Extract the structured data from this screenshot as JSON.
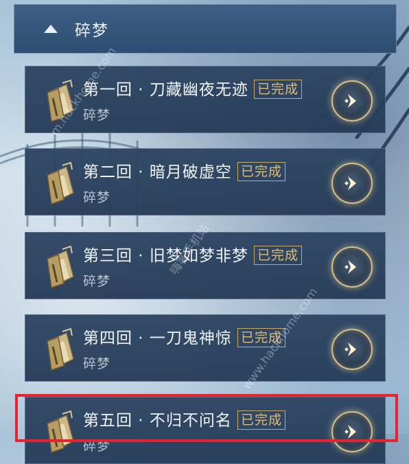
{
  "header": {
    "title": "碎梦",
    "chevron_icon": "chevron-up-icon"
  },
  "chapters": [
    {
      "name": "第一回 · 刀藏幽夜无迹",
      "status": "已完成",
      "subtitle": "碎梦"
    },
    {
      "name": "第二回 · 暗月破虚空",
      "status": "已完成",
      "subtitle": "碎梦"
    },
    {
      "name": "第三回 · 旧梦如梦非梦",
      "status": "已完成",
      "subtitle": "碎梦"
    },
    {
      "name": "第四回 · 一刀鬼神惊",
      "status": "已完成",
      "subtitle": "碎梦"
    },
    {
      "name": "第五回 · 不归不问名",
      "status": "已完成",
      "subtitle": "碎梦"
    }
  ],
  "watermarks": [
    "m.hackhome.com",
    "嗨客手机站",
    "www.hackhome.com"
  ],
  "colors": {
    "accent_gold": "#d8be84",
    "highlight_red": "#e8232b",
    "card_bg": "#2c4462"
  }
}
